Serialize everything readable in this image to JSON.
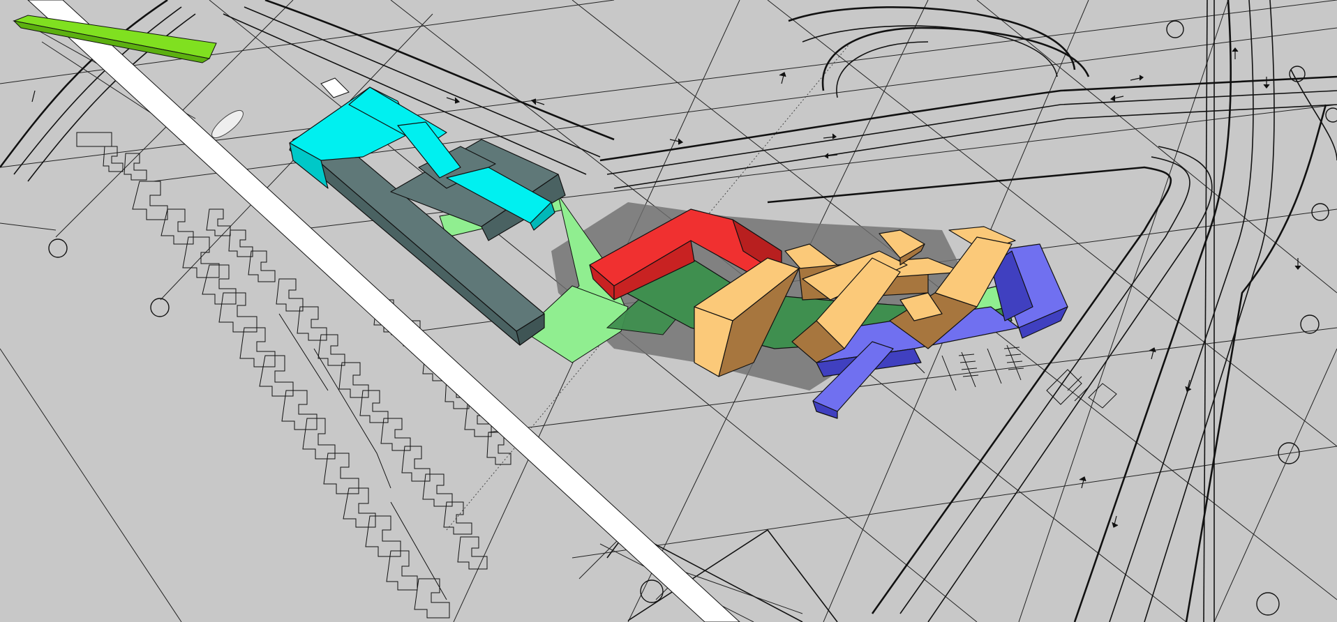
{
  "viewport": {
    "background": "#c8c8c8",
    "ground_shadow_color": "#6f6f6f"
  },
  "colors": {
    "cyan": "#00f0f0",
    "slate": "#5f7878",
    "light_green": "#90ee90",
    "dark_green": "#3f8f4f",
    "red": "#f03030",
    "tan": "#fbc979",
    "tan_dark": "#a7763e",
    "blue": "#7070f0",
    "blue_dark": "#4040c0",
    "lime": "#80e020",
    "white_tube": "#ffffff"
  },
  "icons": {
    "circle_marker": "circle-marker-icon",
    "arrow": "road-arrow-icon"
  }
}
